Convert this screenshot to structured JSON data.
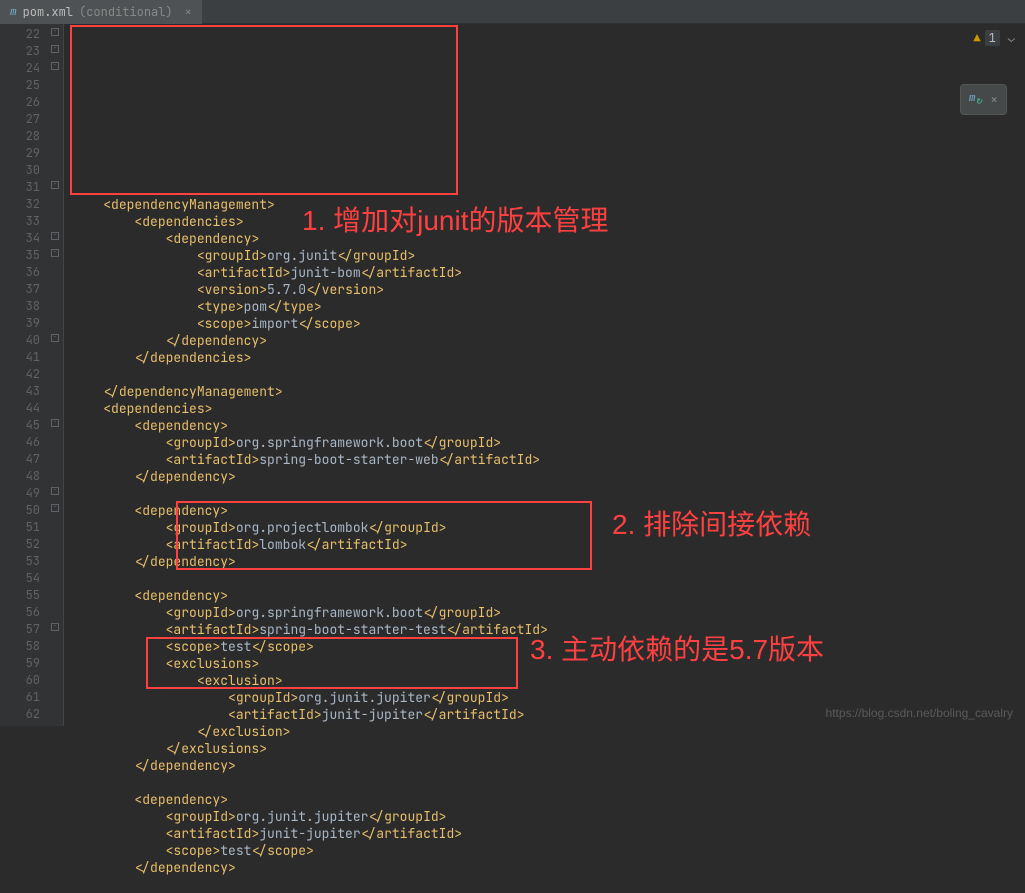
{
  "tab": {
    "filename": "pom.xml",
    "qualifier": "(conditional)"
  },
  "warning": {
    "count": "1"
  },
  "watermark": "https://blog.csdn.net/boling_cavalry",
  "annotations": {
    "a1": "1. 增加对junit的版本管理",
    "a2": "2. 排除间接依赖",
    "a3": "3. 主动依赖的是5.7版本"
  },
  "gutter": {
    "start": 22,
    "end": 62,
    "icons": [
      35,
      40,
      45,
      57
    ]
  },
  "code": {
    "l22": {
      "i": 2,
      "tag": "dependencyManagement",
      "open": true
    },
    "l23": {
      "i": 4,
      "tag": "dependencies",
      "open": true
    },
    "l24": {
      "i": 6,
      "tag": "dependency",
      "open": true
    },
    "l25": {
      "i": 8,
      "tag": "groupId",
      "val": "org.junit"
    },
    "l26": {
      "i": 8,
      "tag": "artifactId",
      "val": "junit-bom"
    },
    "l27": {
      "i": 8,
      "tag": "version",
      "val": "5.7.0"
    },
    "l28": {
      "i": 8,
      "tag": "type",
      "val": "pom"
    },
    "l29": {
      "i": 8,
      "tag": "scope",
      "val": "import"
    },
    "l30": {
      "i": 6,
      "tag": "dependency",
      "close": true
    },
    "l31": {
      "i": 4,
      "tag": "dependencies",
      "close": true
    },
    "l32": {
      "blank": true
    },
    "l33": {
      "i": 2,
      "tag": "dependencyManagement",
      "close": true
    },
    "l34": {
      "i": 2,
      "tag": "dependencies",
      "open": true
    },
    "l35": {
      "i": 4,
      "tag": "dependency",
      "open": true
    },
    "l36": {
      "i": 6,
      "tag": "groupId",
      "val": "org.springframework.boot"
    },
    "l37": {
      "i": 6,
      "tag": "artifactId",
      "val": "spring-boot-starter-web"
    },
    "l38": {
      "i": 4,
      "tag": "dependency",
      "close": true
    },
    "l39": {
      "blank": true
    },
    "l40": {
      "i": 4,
      "tag": "dependency",
      "open": true
    },
    "l41": {
      "i": 6,
      "tag": "groupId",
      "val": "org.projectlombok"
    },
    "l42": {
      "i": 6,
      "tag": "artifactId",
      "val": "lombok"
    },
    "l43": {
      "i": 4,
      "tag": "dependency",
      "close": true
    },
    "l44": {
      "blank": true
    },
    "l45": {
      "i": 4,
      "tag": "dependency",
      "open": true
    },
    "l46": {
      "i": 6,
      "tag": "groupId",
      "val": "org.springframework.boot"
    },
    "l47": {
      "i": 6,
      "tag": "artifactId",
      "val": "spring-boot-starter-test"
    },
    "l48": {
      "i": 6,
      "tag": "scope",
      "val": "test"
    },
    "l49": {
      "i": 6,
      "tag": "exclusions",
      "open": true
    },
    "l50": {
      "i": 8,
      "tag": "exclusion",
      "open": true
    },
    "l51": {
      "i": 10,
      "tag": "groupId",
      "val": "org.junit.jupiter"
    },
    "l52": {
      "i": 10,
      "tag": "artifactId",
      "val": "junit-jupiter"
    },
    "l53": {
      "i": 8,
      "tag": "exclusion",
      "close": true
    },
    "l54": {
      "i": 6,
      "tag": "exclusions",
      "close": true
    },
    "l55": {
      "i": 4,
      "tag": "dependency",
      "close": true
    },
    "l56": {
      "blank": true
    },
    "l57": {
      "i": 4,
      "tag": "dependency",
      "open": true
    },
    "l58": {
      "i": 6,
      "tag": "groupId",
      "val": "org.junit.jupiter"
    },
    "l59": {
      "i": 6,
      "tag": "artifactId",
      "val": "junit-jupiter"
    },
    "l60": {
      "i": 6,
      "tag": "scope",
      "val": "test"
    },
    "l61": {
      "i": 4,
      "tag": "dependency",
      "close": true
    },
    "l62": {
      "blank": true
    }
  }
}
